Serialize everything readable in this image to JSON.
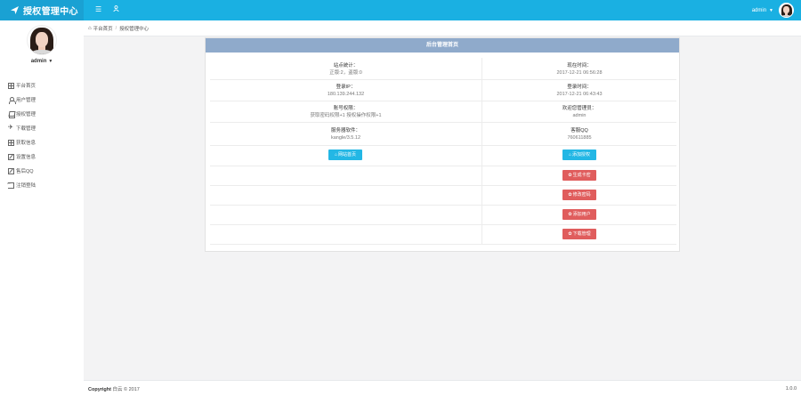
{
  "header": {
    "title": "授权管理中心",
    "menu_icon": "hamburger-icon",
    "user_icon": "user-icon",
    "username": "admin"
  },
  "sidebar": {
    "username": "admin",
    "items": [
      {
        "label": "平台首页",
        "icon": "grid-icon"
      },
      {
        "label": "用户管理",
        "icon": "user-icon"
      },
      {
        "label": "授权管理",
        "icon": "layers-icon"
      },
      {
        "label": "下载管理",
        "icon": "rocket-icon"
      },
      {
        "label": "获取信息",
        "icon": "grid-icon"
      },
      {
        "label": "设置信息",
        "icon": "edit-icon"
      },
      {
        "label": "售后QQ",
        "icon": "edit-icon"
      },
      {
        "label": "注销登陆",
        "icon": "exit-icon"
      }
    ]
  },
  "breadcrumb": {
    "home": "平台首页",
    "separator": "/",
    "current": "授权管理中心"
  },
  "panel": {
    "title": "后台管理首页",
    "rows": [
      {
        "left_label": "站点统计：",
        "left_value": "正版:2，盗版:0",
        "right_label": "现在时间：",
        "right_value": "2017-12-21 06:56:28"
      },
      {
        "left_label": "登录IP：",
        "left_value": "180.139.244.132",
        "right_label": "登录时间：",
        "right_value": "2017-12-21 06:43:43"
      },
      {
        "left_label": "账号权限：",
        "left_value": "获取密码权限+1 授权操作权限+1",
        "right_label": "欢迎您管理员：",
        "right_value": "admin"
      },
      {
        "left_label": "服务器软件：",
        "left_value": "kangle/3.5.12",
        "right_label": "客服QQ",
        "right_value": "760611885"
      }
    ],
    "left_button": "网站首页",
    "right_buttons": [
      {
        "label": "添加授权",
        "color": "#23b7e5"
      },
      {
        "label": "生成卡密",
        "color": "#e05d5d"
      },
      {
        "label": "修改密码",
        "color": "#e05d5d"
      },
      {
        "label": "添加用户",
        "color": "#e05d5d"
      },
      {
        "label": "下载管理",
        "color": "#e05d5d"
      }
    ]
  },
  "footer": {
    "copyright_label": "Copyright",
    "copyright_text": "白云 © 2017",
    "version": "1.0.0"
  },
  "colors": {
    "topbar": "#1ab0e2",
    "brand": "#1aa1d3",
    "panel_head": "#8faacb",
    "btn_blue": "#23b7e5",
    "btn_red": "#e05d5d"
  }
}
